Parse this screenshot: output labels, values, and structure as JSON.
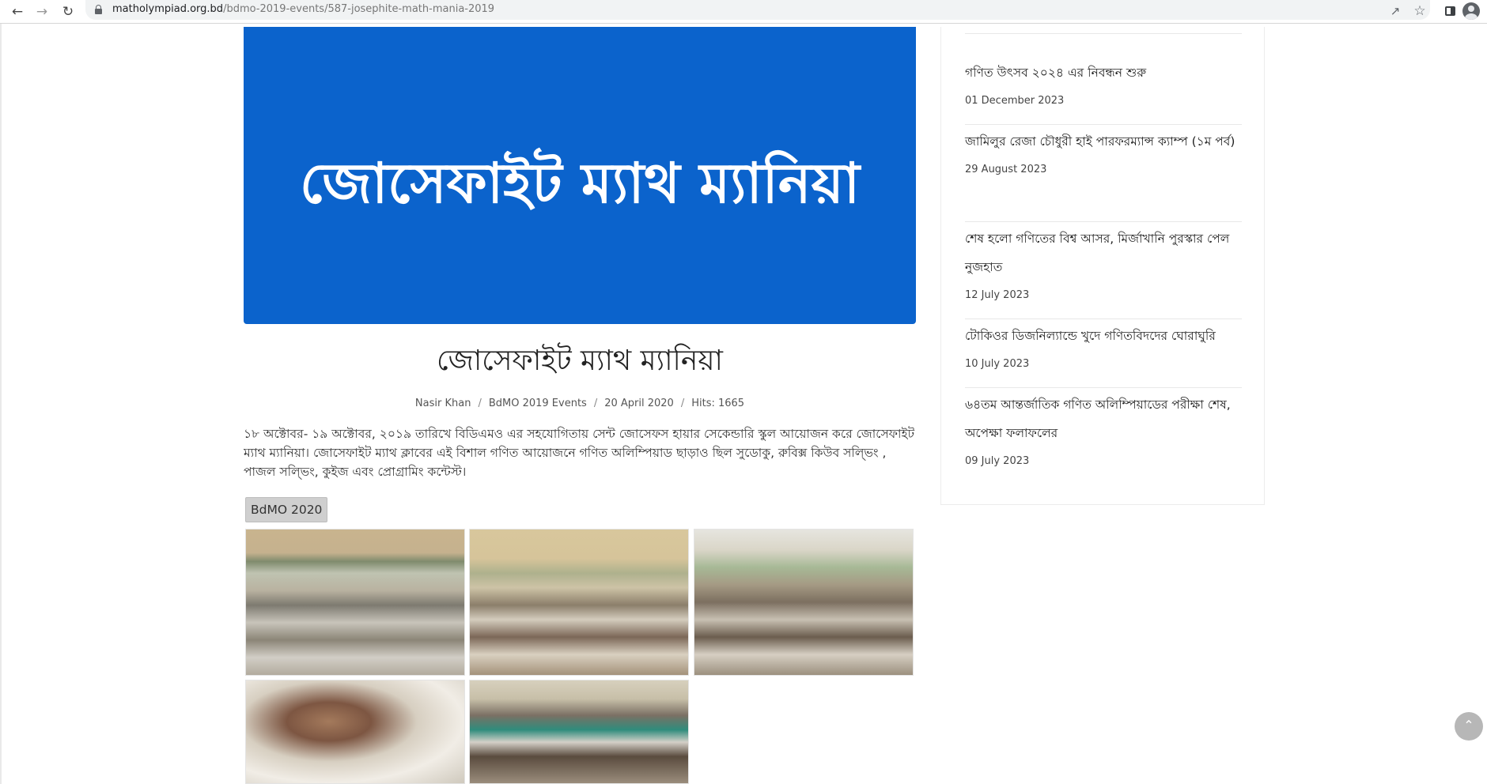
{
  "browser": {
    "url_domain": "matholympiad.org.bd",
    "url_path": "/bdmo-2019-events/587-josephite-math-mania-2019",
    "icons": [
      "back-arrow-icon",
      "forward-arrow-icon",
      "reload-icon",
      "lock-icon",
      "share-icon",
      "star-icon",
      "side-panel-icon",
      "profile-icon"
    ]
  },
  "hero": {
    "text": "জোসেফাইট ম্যাথ ম্যানিয়া",
    "background": "#0b63cc"
  },
  "article": {
    "title": "জোসেফাইট ম্যাথ ম্যানিয়া",
    "meta": {
      "author": "Nasir Khan",
      "category": "BdMO 2019 Events",
      "date": "20 April 2020",
      "hits": "Hits: 1665",
      "separator": "/"
    },
    "body": "১৮ অক্টোবর- ১৯ অক্টোবর, ২০১৯ তারিখে বিডিএমও এর সহযোগিতায় সেন্ট জোসেফস হায়ার সেকেন্ডারি স্কুল আয়োজন করে জোসেফাইট ম্যাথ ম্যানিয়া। জোসেফাইট ম্যাথ ক্লাবের এই বিশাল গণিত আয়োজনে গণিত অলিম্পিয়াড ছাড়াও ছিল সুডোকু, রুবিক্স কিউব সল্ভিং , পাজল সল্ভিং, কুইজ এবং প্রোগ্রামিং কন্টেস্ট।",
    "gallery_tag": "BdMO 2020"
  },
  "sidebar": {
    "posts": [
      {
        "title": "গণিত উৎসব ২০২৪ এর নিবন্ধন শুরু",
        "date": "01 December 2023"
      },
      {
        "title": "জামিলুর রেজা চৌধুরী হাই পারফরম্যান্স ক্যাম্প (১ম পর্ব)",
        "date": "29 August 2023"
      },
      {
        "title": "শেষ হলো গণিতের বিশ্ব আসর, মির্জাখানি পুরস্কার পেল নুজহাত",
        "date": "12 July 2023"
      },
      {
        "title": "টোকিওর ডিজনিল্যান্ডে খুদে গণিতবিদদের ঘোরাঘুরি",
        "date": "10 July 2023"
      },
      {
        "title": "৬৪তম আন্তর্জাতিক গণিত অলিম্পিয়াডের পরীক্ষা শেষ, অপেক্ষা ফলাফলের",
        "date": "09 July 2023"
      }
    ]
  }
}
